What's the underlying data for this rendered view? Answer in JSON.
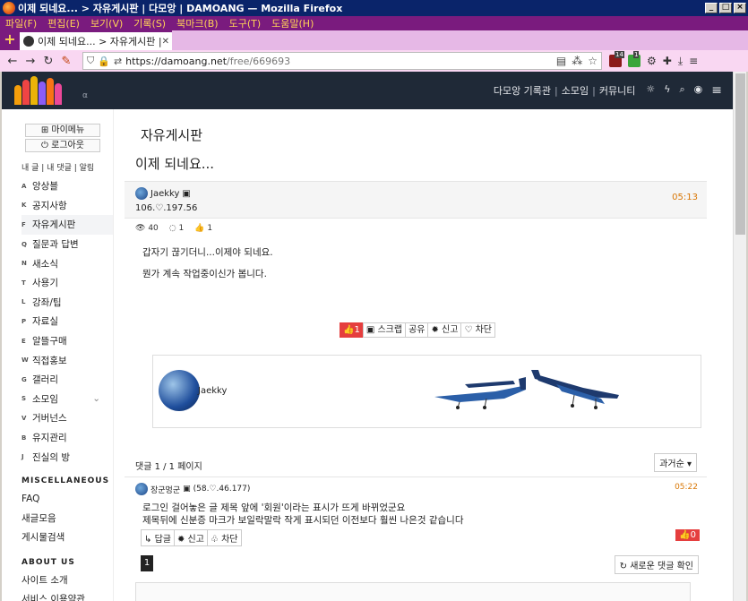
{
  "window": {
    "title": "이제 되네요... > 자유게시판 | 다모앙 | DAMOANG — Mozilla Firefox"
  },
  "menu": [
    "파일(F)",
    "편집(E)",
    "보기(V)",
    "기록(S)",
    "북마크(B)",
    "도구(T)",
    "도움말(H)"
  ],
  "tab": {
    "label": "이제 되네요... > 자유게시판 |"
  },
  "urlbar": {
    "host": "https://damoang.net",
    "path": "/free/669693"
  },
  "extensions": {
    "badge1": "14",
    "badge2": "1"
  },
  "header": {
    "alpha": "α",
    "menu": [
      "다모앙 기록관",
      "소모임",
      "커뮤니티"
    ]
  },
  "sidebar": {
    "my_menu": "마이메뉴",
    "logout": "로그아웃",
    "mini_links": "내 글 | 내 댓글 | 알림",
    "items": [
      {
        "key": "A",
        "label": "앙상블"
      },
      {
        "key": "K",
        "label": "공지사항"
      },
      {
        "key": "F",
        "label": "자유게시판"
      },
      {
        "key": "Q",
        "label": "질문과 답변"
      },
      {
        "key": "N",
        "label": "새소식"
      },
      {
        "key": "T",
        "label": "사용기"
      },
      {
        "key": "L",
        "label": "강좌/팁"
      },
      {
        "key": "P",
        "label": "자료실"
      },
      {
        "key": "E",
        "label": "알뜰구매"
      },
      {
        "key": "W",
        "label": "직접홍보"
      },
      {
        "key": "G",
        "label": "갤러리"
      },
      {
        "key": "S",
        "label": "소모임"
      },
      {
        "key": "V",
        "label": "거버넌스"
      },
      {
        "key": "B",
        "label": "유지관리"
      },
      {
        "key": "J",
        "label": "진실의 방"
      }
    ],
    "misc_title": "MISCELLANEOUS",
    "misc": [
      "FAQ",
      "새글모음",
      "게시물검색"
    ],
    "about_title": "ABOUT US",
    "about": [
      "사이트 소개",
      "서비스 이용약관"
    ]
  },
  "board_title": "자유게시판",
  "post": {
    "title": "이제 되네요...",
    "author": "Jaekky",
    "ip": "106.♡.197.56",
    "time": "05:13",
    "views": "40",
    "comments": "1",
    "likes": "1",
    "body": [
      "갑자기 끊기더니...이제야 되네요.",
      "뭔가 계속 작업중이신가 봅니다."
    ],
    "actions": [
      "1",
      "스크랩",
      "공유",
      "신고",
      "차단"
    ],
    "signature_name": "Jaekky"
  },
  "comments": {
    "count_text": "댓글 1 / 1 페이지",
    "sort": "과거순",
    "items": [
      {
        "author": "장군멍군",
        "info": "(58.♡.46.177)",
        "time": "05:22",
        "lines": [
          "로그인 걸어놓은 글 제목 앞에 '회원'이라는 표시가 뜨게 바뀌었군요",
          "제목뒤에 신분증 마크가 보일락말락 작게 표시되던 이전보다 훨씬 나은것 같습니다"
        ],
        "actions": [
          "답글",
          "신고",
          "차단"
        ],
        "likes": "0"
      }
    ],
    "page": "1",
    "refresh": "새로운 댓글 확인"
  }
}
